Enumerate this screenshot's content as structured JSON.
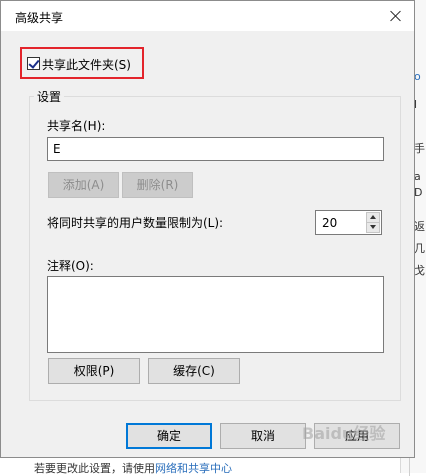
{
  "dialog": {
    "title": "高级共享",
    "share_checkbox": {
      "label": "共享此文件夹(S)",
      "checked": true
    },
    "group_label": "设置",
    "share_name": {
      "label": "共享名(H):",
      "value": "E"
    },
    "buttons": {
      "add": "添加(A)",
      "remove": "删除(R)"
    },
    "user_limit": {
      "label": "将同时共享的用户数量限制为(L):",
      "value": "20"
    },
    "comment": {
      "label": "注释(O):",
      "value": ""
    },
    "actions": {
      "permissions": "权限(P)",
      "cache": "缓存(C)"
    },
    "footer": {
      "ok": "确定",
      "cancel": "取消",
      "apply": "应用"
    }
  },
  "background": {
    "right_fragments": [
      "o",
      "l",
      "手",
      "a",
      "D",
      "返",
      "几",
      "戈"
    ],
    "bottom_text": "若要更改此设置，请使用",
    "bottom_link": "网络和共享中心"
  },
  "watermark": "Baidu经验",
  "colors": {
    "highlight": "#e3242b",
    "primary_border": "#0078d7",
    "dialog_bg": "#f0f0f0"
  }
}
